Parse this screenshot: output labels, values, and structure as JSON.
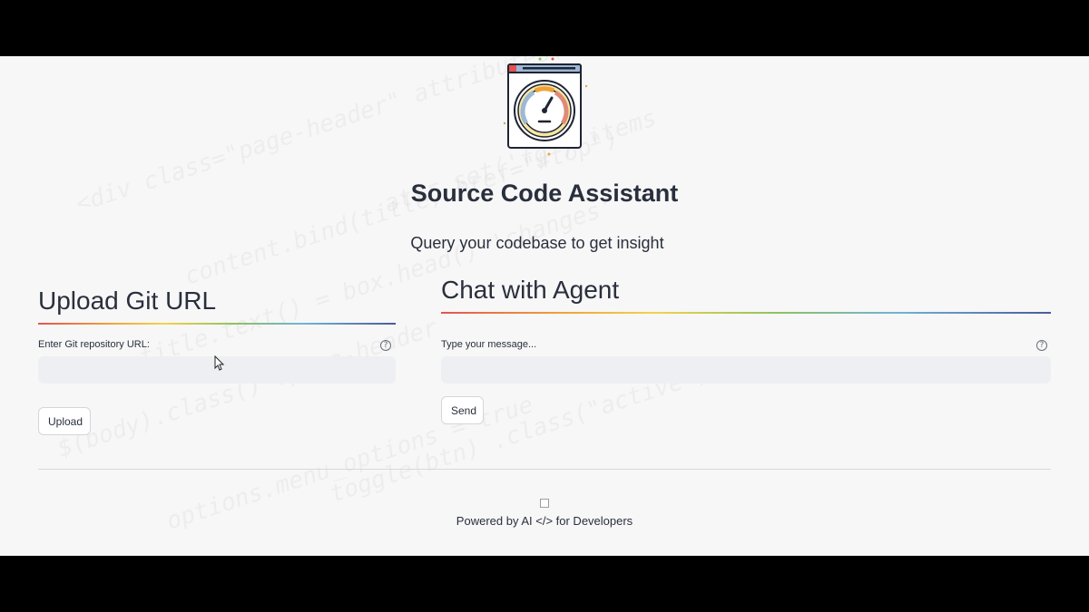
{
  "header": {
    "title": "Source Code Assistant",
    "subtitle": "Query your codebase to get insight",
    "logo_icon": "speedometer-window-icon"
  },
  "upload_panel": {
    "heading": "Upload Git URL",
    "field_label": "Enter Git repository URL:",
    "field_value": "",
    "field_placeholder": "",
    "help_icon": "question-circle-icon",
    "button_label": "Upload"
  },
  "chat_panel": {
    "heading": "Chat with Agent",
    "field_label": "Type your message...",
    "field_value": "",
    "field_placeholder": "",
    "help_icon": "question-circle-icon",
    "button_label": "Send"
  },
  "footer": {
    "image_icon": "broken-image-icon",
    "text": "Powered by AI </> for Developers"
  },
  "colors": {
    "page_background": "#f7f7f7",
    "text": "#2a2f3d",
    "input_background": "#eeeff2",
    "divider_gradient": [
      "#e4534f",
      "#f0a23a",
      "#f2d34a",
      "#8fc25f",
      "#6fb3d8",
      "#4a5a9c"
    ]
  }
}
